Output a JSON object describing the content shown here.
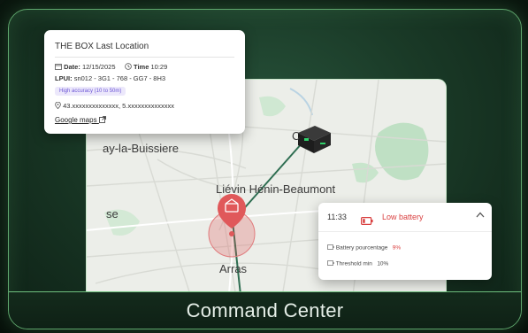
{
  "location_card": {
    "title": "THE BOX Last Location",
    "date_label": "Date:",
    "date_value": "12/15/2025",
    "time_label": "Time",
    "time_value": "10:29",
    "lpui_label": "LPUI:",
    "lpui_value": "sn012 - 3G1 - 768 - GG7 - 8H3",
    "accuracy_badge": "High accuracy (10 to 50m)",
    "coordinates": "43.xxxxxxxxxxxxxx, 5.xxxxxxxxxxxxxx",
    "google_maps_link": "Google maps"
  },
  "map": {
    "labels": {
      "buissiere": "ay-la-Buissiere",
      "lievin": "Liévin Hénin-Beaumont",
      "arras": "Arras",
      "se": "se",
      "c": "C"
    }
  },
  "alert_card": {
    "time": "11:33",
    "status": "Low battery",
    "battery_label": "Battery pourcentage",
    "battery_value": "9%",
    "threshold_label": "Threshold min",
    "threshold_value": "10%"
  },
  "footer": {
    "title": "Command Center"
  },
  "colors": {
    "accent_green": "#5fa76d",
    "marker_red": "#e0585a",
    "alert_red": "#d94040",
    "badge_purple": "#6b55d6",
    "route_green": "#2f6e52"
  }
}
